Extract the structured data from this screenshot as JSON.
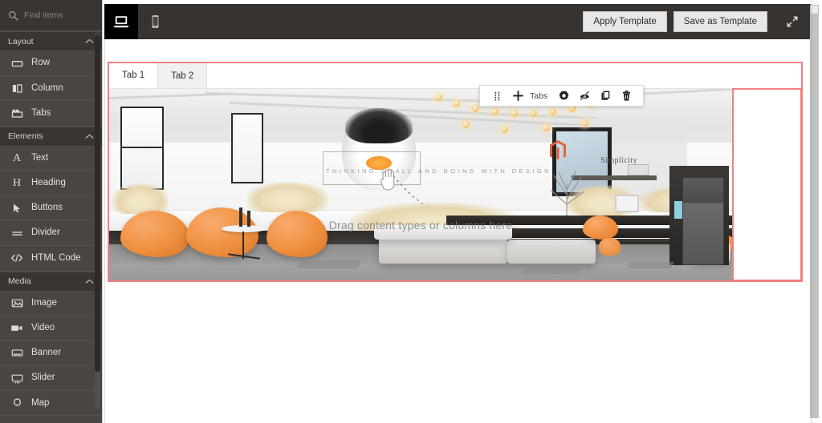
{
  "sidebar": {
    "search": {
      "placeholder": "Find items",
      "value": "",
      "icon": "search-icon"
    },
    "groups": [
      {
        "name": "Layout",
        "label": "Layout",
        "collapse_icon": "chevron-up-icon",
        "items": [
          {
            "label": "Row",
            "icon": "row-icon"
          },
          {
            "label": "Column",
            "icon": "column-icon"
          },
          {
            "label": "Tabs",
            "icon": "tabs-icon"
          }
        ]
      },
      {
        "name": "Elements",
        "label": "Elements",
        "collapse_icon": "chevron-up-icon",
        "items": [
          {
            "label": "Text",
            "icon": "text-a-icon"
          },
          {
            "label": "Heading",
            "icon": "heading-h-icon"
          },
          {
            "label": "Buttons",
            "icon": "cursor-arrow-icon"
          },
          {
            "label": "Divider",
            "icon": "divider-icon"
          },
          {
            "label": "HTML Code",
            "icon": "code-brackets-icon"
          }
        ]
      },
      {
        "name": "Media",
        "label": "Media",
        "collapse_icon": "chevron-up-icon",
        "items": [
          {
            "label": "Image",
            "icon": "image-icon"
          },
          {
            "label": "Video",
            "icon": "video-camera-icon"
          },
          {
            "label": "Banner",
            "icon": "banner-icon"
          },
          {
            "label": "Slider",
            "icon": "slider-icon"
          },
          {
            "label": "Map",
            "icon": "map-pin-icon"
          }
        ]
      }
    ]
  },
  "topbar": {
    "viewports": [
      {
        "name": "desktop",
        "icon": "laptop-icon",
        "active": true
      },
      {
        "name": "mobile",
        "icon": "mobile-phone-icon",
        "active": false
      }
    ],
    "apply_template_label": "Apply Template",
    "save_as_template_label": "Save as Template",
    "expand_icon": "collapse-diagonal-icon"
  },
  "option_toolbar": {
    "element_label": "Tabs",
    "buttons": [
      {
        "name": "drag-handle",
        "icon": "drag-dots-icon",
        "title": "Move"
      },
      {
        "name": "add-tab",
        "icon": "plus-icon",
        "title": "Add"
      },
      {
        "name": "settings",
        "icon": "gear-icon",
        "title": "Settings"
      },
      {
        "name": "hide",
        "icon": "eye-slash-icon",
        "title": "Hide"
      },
      {
        "name": "duplicate",
        "icon": "duplicate-icon",
        "title": "Duplicate"
      },
      {
        "name": "remove",
        "icon": "trash-icon",
        "title": "Remove"
      }
    ]
  },
  "canvas": {
    "tabs": [
      {
        "label": "Tab 1",
        "active": true
      },
      {
        "label": "Tab 2",
        "active": false
      }
    ],
    "drop_hint": "Drag content types or columns here",
    "banner": {
      "overlay_text": "THINKING SMALL AND DOING WITH DESIGN",
      "brand_mark": "magento-logo-icon",
      "wall_word": "Simplicity"
    },
    "empty_column_placeholder": ""
  },
  "colors": {
    "sidebar_bg": "#4a4540",
    "sidebar_group_bg": "#393530",
    "topbar_bg": "#373330",
    "selection_outline": "#f08080",
    "button_bg": "#e8e7e5",
    "accent_orange": "#ef8f3f"
  }
}
